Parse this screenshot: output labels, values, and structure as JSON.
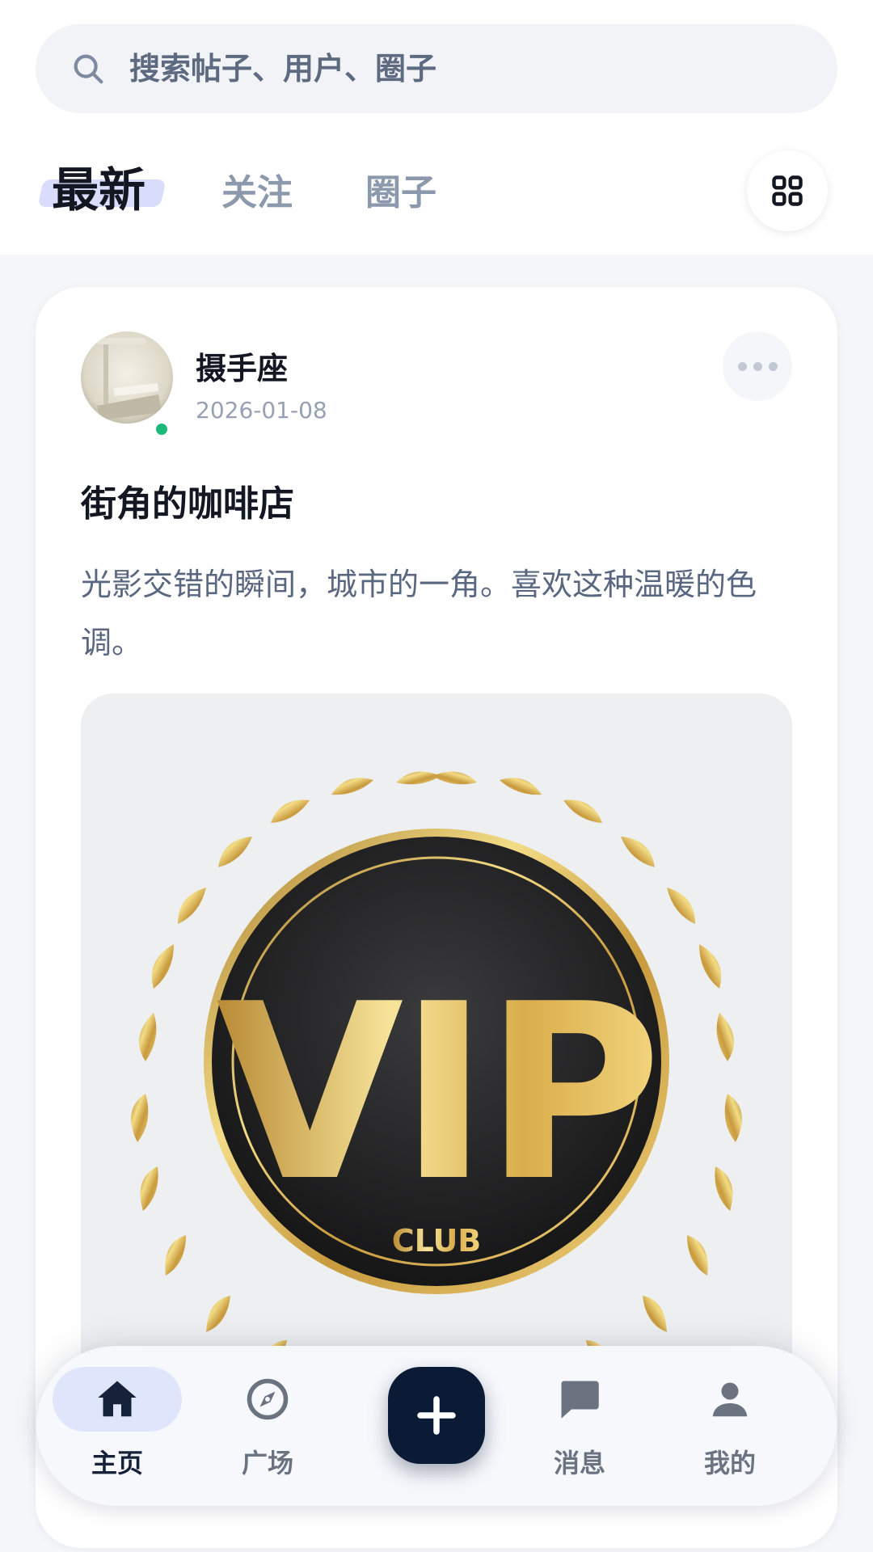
{
  "search": {
    "placeholder": "搜索帖子、用户、圈子"
  },
  "tabs": [
    {
      "label": "最新",
      "active": true
    },
    {
      "label": "关注",
      "active": false
    },
    {
      "label": "圈子",
      "active": false
    }
  ],
  "icons": {
    "search": "search-icon",
    "grid": "grid-icon",
    "more": "more-horizontal-icon",
    "home": "home-icon",
    "plaza": "compass-icon",
    "create": "plus-icon",
    "messages": "chat-bubble-icon",
    "profile": "user-icon"
  },
  "post": {
    "author": "摄手座",
    "date": "2026-01-08",
    "online": true,
    "title": "街角的咖啡店",
    "body": "光影交错的瞬间，城市的一角。喜欢这种温暖的色调。",
    "image": {
      "badge_text": "VIP",
      "badge_subtext": "CLUB"
    }
  },
  "nav": {
    "items": [
      {
        "label": "主页",
        "active": true
      },
      {
        "label": "广场",
        "active": false
      },
      {
        "label": "消息",
        "active": false
      },
      {
        "label": "我的",
        "active": false
      }
    ]
  },
  "colors": {
    "accent_dark": "#0b1b36",
    "online": "#1db97a",
    "active_pill": "#dfe6fc",
    "gold": "#d9b45a"
  }
}
